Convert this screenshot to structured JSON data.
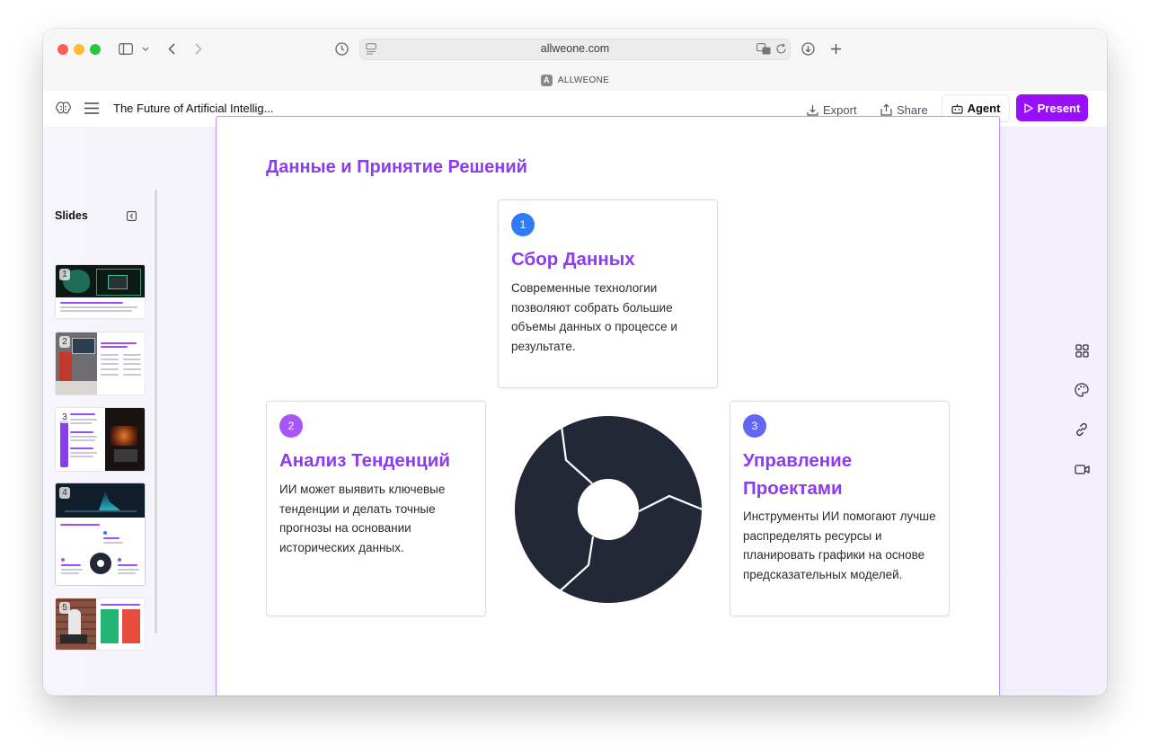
{
  "browser": {
    "url": "allweone.com",
    "tab_label": "ALLWEONE",
    "tab_favicon_letter": "A"
  },
  "app": {
    "doc_title": "The Future of Artificial Intellig...",
    "export_label": "Export",
    "share_label": "Share",
    "agent_label": "Agent",
    "present_label": "Present",
    "accent_color": "#9810fa"
  },
  "sidebar": {
    "title": "Slides",
    "slides": [
      {
        "number": "1"
      },
      {
        "number": "2"
      },
      {
        "number": "3"
      },
      {
        "number": "4"
      },
      {
        "number": "5"
      }
    ]
  },
  "slide": {
    "title": "Данные и Принятие Решений",
    "title_color": "#8b3cf0",
    "cards": [
      {
        "number": "1",
        "badge_color": "#2f7cf6",
        "title": "Сбор Данных",
        "body": "Современные технологии позволяют собрать большие объемы данных о процессе и результате."
      },
      {
        "number": "2",
        "badge_color": "#a855f7",
        "title": "Анализ Тенденций",
        "body": "ИИ может выявить ключевые тенденции и делать точные прогнозы на основании исторических данных."
      },
      {
        "number": "3",
        "badge_color": "#6366f1",
        "title": "Управление Проектами",
        "body": "Инструменты ИИ помогают лучше распределять ресурсы и планировать графики на основе предсказательных моделей."
      }
    ],
    "cycle_color": "#222836"
  },
  "right_tools": [
    "grid-icon",
    "palette-icon",
    "link-icon",
    "video-icon"
  ]
}
